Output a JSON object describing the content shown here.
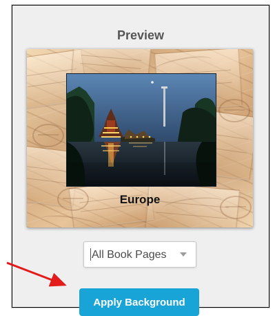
{
  "preview": {
    "title": "Preview",
    "caption": "Europe"
  },
  "page_select": {
    "value": "All Book Pages"
  },
  "actions": {
    "apply_background_label": "Apply Background"
  },
  "colors": {
    "panel": "#efefef",
    "button": "#19a4d8",
    "arrow": "#e31b1b"
  },
  "icons": {
    "dropdown": "chevron-down-icon",
    "annotation": "red-arrow-icon"
  }
}
